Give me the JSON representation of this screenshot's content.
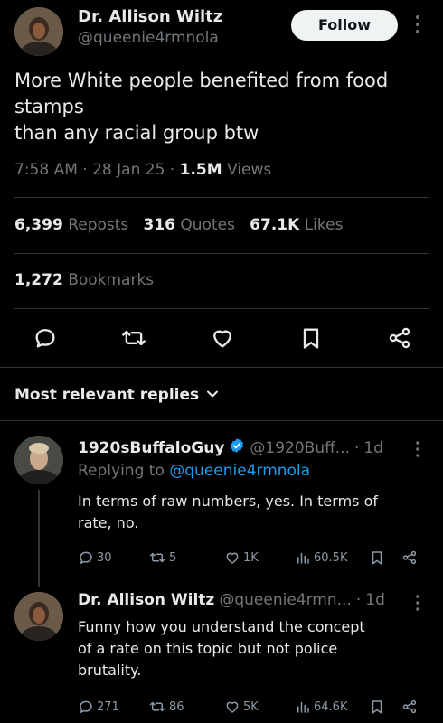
{
  "tweet": {
    "author_name": "Dr. Allison Wiltz",
    "author_handle": "@queenie4rmnola",
    "follow_label": "Follow",
    "text_line1": "More White people benefited from food",
    "text_line2": "stamps",
    "text_line3": "than any racial group btw",
    "time": "7:58 AM",
    "date": "28 Jan 25",
    "views_count": "1.5M",
    "views_label": "Views",
    "reposts_count": "6,399",
    "reposts_label": "Reposts",
    "quotes_count": "316",
    "quotes_label": "Quotes",
    "likes_count": "67.1K",
    "likes_label": "Likes",
    "bookmarks_count": "1,272",
    "bookmarks_label": "Bookmarks",
    "sep": "·"
  },
  "replies_header": "Most relevant replies",
  "replies": [
    {
      "name": "1920sBuffaloGuy",
      "handle": "@1920Buff...",
      "age": "1d",
      "replying_prefix": "Replying to",
      "replying_to": "@queenie4rmnola",
      "text_line1": "In terms of raw numbers, yes. In terms of",
      "text_line2": "rate, no.",
      "replies": "30",
      "reposts": "5",
      "likes": "1K",
      "views": "60.5K"
    },
    {
      "name": "Dr. Allison Wiltz",
      "handle": "@queenie4rmn...",
      "age": "1d",
      "text_line1": "Funny how you understand the concept",
      "text_line2": "of a rate on this topic but not police",
      "text_line3": "brutality.",
      "replies": "271",
      "reposts": "86",
      "likes": "5K",
      "views": "64.6K"
    }
  ],
  "colors": {
    "background": "#000000",
    "text": "#e7e9ea",
    "muted": "#71767b",
    "link": "#1d9bf0",
    "verified": "#1d9bf0"
  },
  "icons": [
    "more-icon",
    "reply-icon",
    "repost-icon",
    "like-icon",
    "bookmark-icon",
    "share-icon",
    "chevron-down-icon",
    "verified-icon",
    "views-icon"
  ]
}
